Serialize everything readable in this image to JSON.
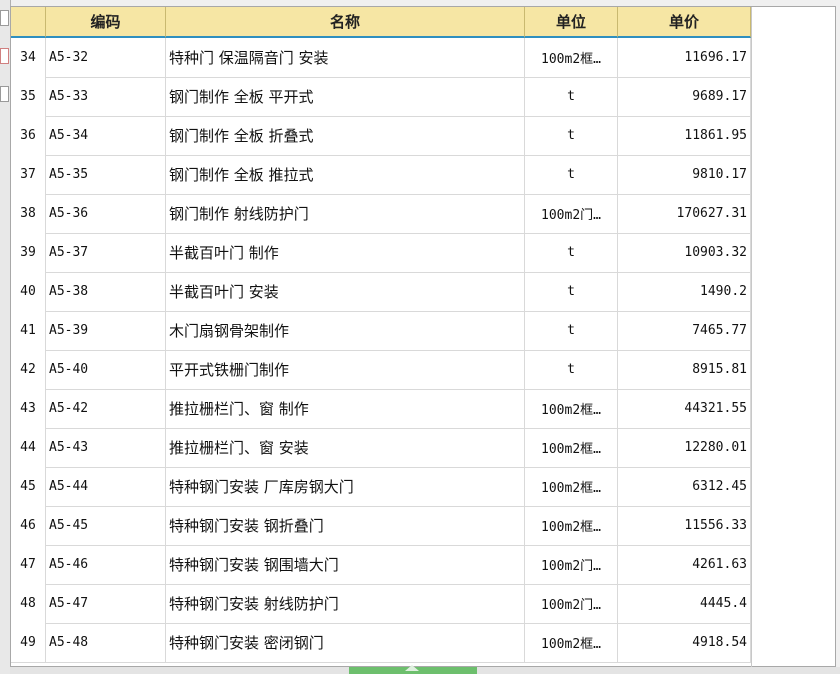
{
  "table": {
    "headers": {
      "code": "编码",
      "name": "名称",
      "unit": "单位",
      "price": "单价"
    },
    "rows": [
      {
        "no": "34",
        "code": "A5-32",
        "name": "特种门 保温隔音门 安装",
        "unit": "100m2框…",
        "price": "11696.17"
      },
      {
        "no": "35",
        "code": "A5-33",
        "name": "钢门制作 全板 平开式",
        "unit": "t",
        "price": "9689.17"
      },
      {
        "no": "36",
        "code": "A5-34",
        "name": "钢门制作 全板 折叠式",
        "unit": "t",
        "price": "11861.95"
      },
      {
        "no": "37",
        "code": "A5-35",
        "name": "钢门制作 全板 推拉式",
        "unit": "t",
        "price": "9810.17"
      },
      {
        "no": "38",
        "code": "A5-36",
        "name": "钢门制作 射线防护门",
        "unit": "100m2门…",
        "price": "170627.31"
      },
      {
        "no": "39",
        "code": "A5-37",
        "name": "半截百叶门 制作",
        "unit": "t",
        "price": "10903.32"
      },
      {
        "no": "40",
        "code": "A5-38",
        "name": "半截百叶门 安装",
        "unit": "t",
        "price": "1490.2"
      },
      {
        "no": "41",
        "code": "A5-39",
        "name": "木门扇钢骨架制作",
        "unit": "t",
        "price": "7465.77"
      },
      {
        "no": "42",
        "code": "A5-40",
        "name": "平开式铁栅门制作",
        "unit": "t",
        "price": "8915.81"
      },
      {
        "no": "43",
        "code": "A5-42",
        "name": "推拉栅栏门、窗 制作",
        "unit": "100m2框…",
        "price": "44321.55"
      },
      {
        "no": "44",
        "code": "A5-43",
        "name": "推拉栅栏门、窗 安装",
        "unit": "100m2框…",
        "price": "12280.01"
      },
      {
        "no": "45",
        "code": "A5-44",
        "name": "特种钢门安装 厂库房钢大门",
        "unit": "100m2框…",
        "price": "6312.45"
      },
      {
        "no": "46",
        "code": "A5-45",
        "name": "特种钢门安装 钢折叠门",
        "unit": "100m2框…",
        "price": "11556.33"
      },
      {
        "no": "47",
        "code": "A5-46",
        "name": "特种钢门安装 钢围墙大门",
        "unit": "100m2门…",
        "price": "4261.63"
      },
      {
        "no": "48",
        "code": "A5-47",
        "name": "特种钢门安装 射线防护门",
        "unit": "100m2门…",
        "price": "4445.4"
      },
      {
        "no": "49",
        "code": "A5-48",
        "name": "特种钢门安装 密闭钢门",
        "unit": "100m2框…",
        "price": "4918.54"
      }
    ]
  }
}
